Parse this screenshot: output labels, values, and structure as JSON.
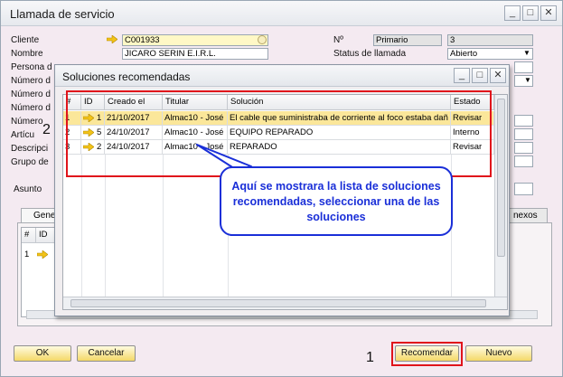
{
  "main": {
    "title": "Llamada de servicio",
    "labels": [
      "Cliente",
      "Nombre",
      "Persona d",
      "Número d",
      "Número d",
      "Número d",
      "Número",
      "Artícu",
      "Descripci",
      "Grupo de"
    ],
    "cliente_value": "C001933",
    "nombre_value": "JICARO SERIN E.I.R.L.",
    "no_label": "Nº",
    "no_series": "Primario",
    "no_value": "3",
    "status_label": "Status de llamada",
    "status_value": "Abierto",
    "asunto_label": "Asunto",
    "tab_general": "Gene",
    "tab_anexos": "nexos",
    "bottom_grid": {
      "hash": "#",
      "id": "ID",
      "row1": "1"
    },
    "buttons": {
      "ok": "OK",
      "cancel": "Cancelar",
      "recommend": "Recomendar",
      "new": "Nuevo"
    },
    "markers": {
      "one": "1",
      "two": "2"
    }
  },
  "dialog": {
    "title": "Soluciones recomendadas",
    "columns": [
      "#",
      "ID",
      "Creado el",
      "Titular",
      "Solución",
      "Estado"
    ],
    "rows": [
      {
        "n": "1",
        "id": "1",
        "date": "21/10/2017",
        "owner": "Almac10 - José",
        "solution": "El cable que suministraba de corriente al foco estaba dañ",
        "status": "Revisar"
      },
      {
        "n": "2",
        "id": "5",
        "date": "24/10/2017",
        "owner": "Almac10 - José",
        "solution": "EQUIPO REPARADO",
        "status": "Interno"
      },
      {
        "n": "3",
        "id": "2",
        "date": "24/10/2017",
        "owner": "Almac10 - José",
        "solution": "REPARADO",
        "status": "Revisar"
      }
    ],
    "callout": "Aquí se mostrara la lista de soluciones recomendadas, seleccionar una de las soluciones"
  },
  "colors": {
    "accent_red": "#e0141b",
    "callout_blue": "#1a2fd8",
    "button_yellow": "#f4d867",
    "selected_row": "#fbe79a"
  }
}
